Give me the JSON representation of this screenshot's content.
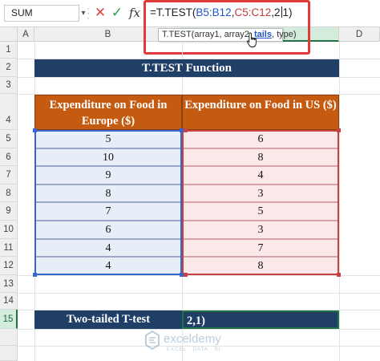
{
  "formula_bar": {
    "name_box": "SUM",
    "formula_parts": {
      "prefix": "=T.TEST(",
      "range1": "B5:B12",
      "comma1": ",",
      "range2": "C5:C12",
      "mid": ",2",
      "suffix": "1)"
    },
    "tooltip": {
      "fn": "T.TEST(",
      "arg1": "array1, ",
      "arg2": "array2, ",
      "arg3": "tails",
      "arg4": ", type)"
    }
  },
  "columns": [
    "A",
    "B",
    "C",
    "D"
  ],
  "rows": [
    "1",
    "2",
    "3",
    "4",
    "5",
    "6",
    "7",
    "8",
    "9",
    "10",
    "11",
    "12",
    "13",
    "14",
    "15"
  ],
  "title": "T.TEST Function",
  "table": {
    "headers": [
      "Expenditure on Food in Europe ($)",
      "Expenditure on Food in US ($)"
    ],
    "europe": [
      "5",
      "10",
      "9",
      "8",
      "7",
      "6",
      "4",
      "4"
    ],
    "us": [
      "6",
      "8",
      "4",
      "3",
      "5",
      "3",
      "7",
      "8"
    ]
  },
  "result": {
    "label": "Two-tailed T-test",
    "value": "2,1)"
  },
  "watermark": {
    "brand": "exceldemy",
    "tagline": "EXCEL · DATA · BI"
  },
  "colors": {
    "title_bg": "#1f3f66",
    "header_bg": "#c55a11",
    "europe_fill": "#e8eef8",
    "us_fill": "#fbe9ea",
    "range1_border": "#3466cc",
    "range2_border": "#c94040",
    "highlight": "#e03b3b"
  }
}
